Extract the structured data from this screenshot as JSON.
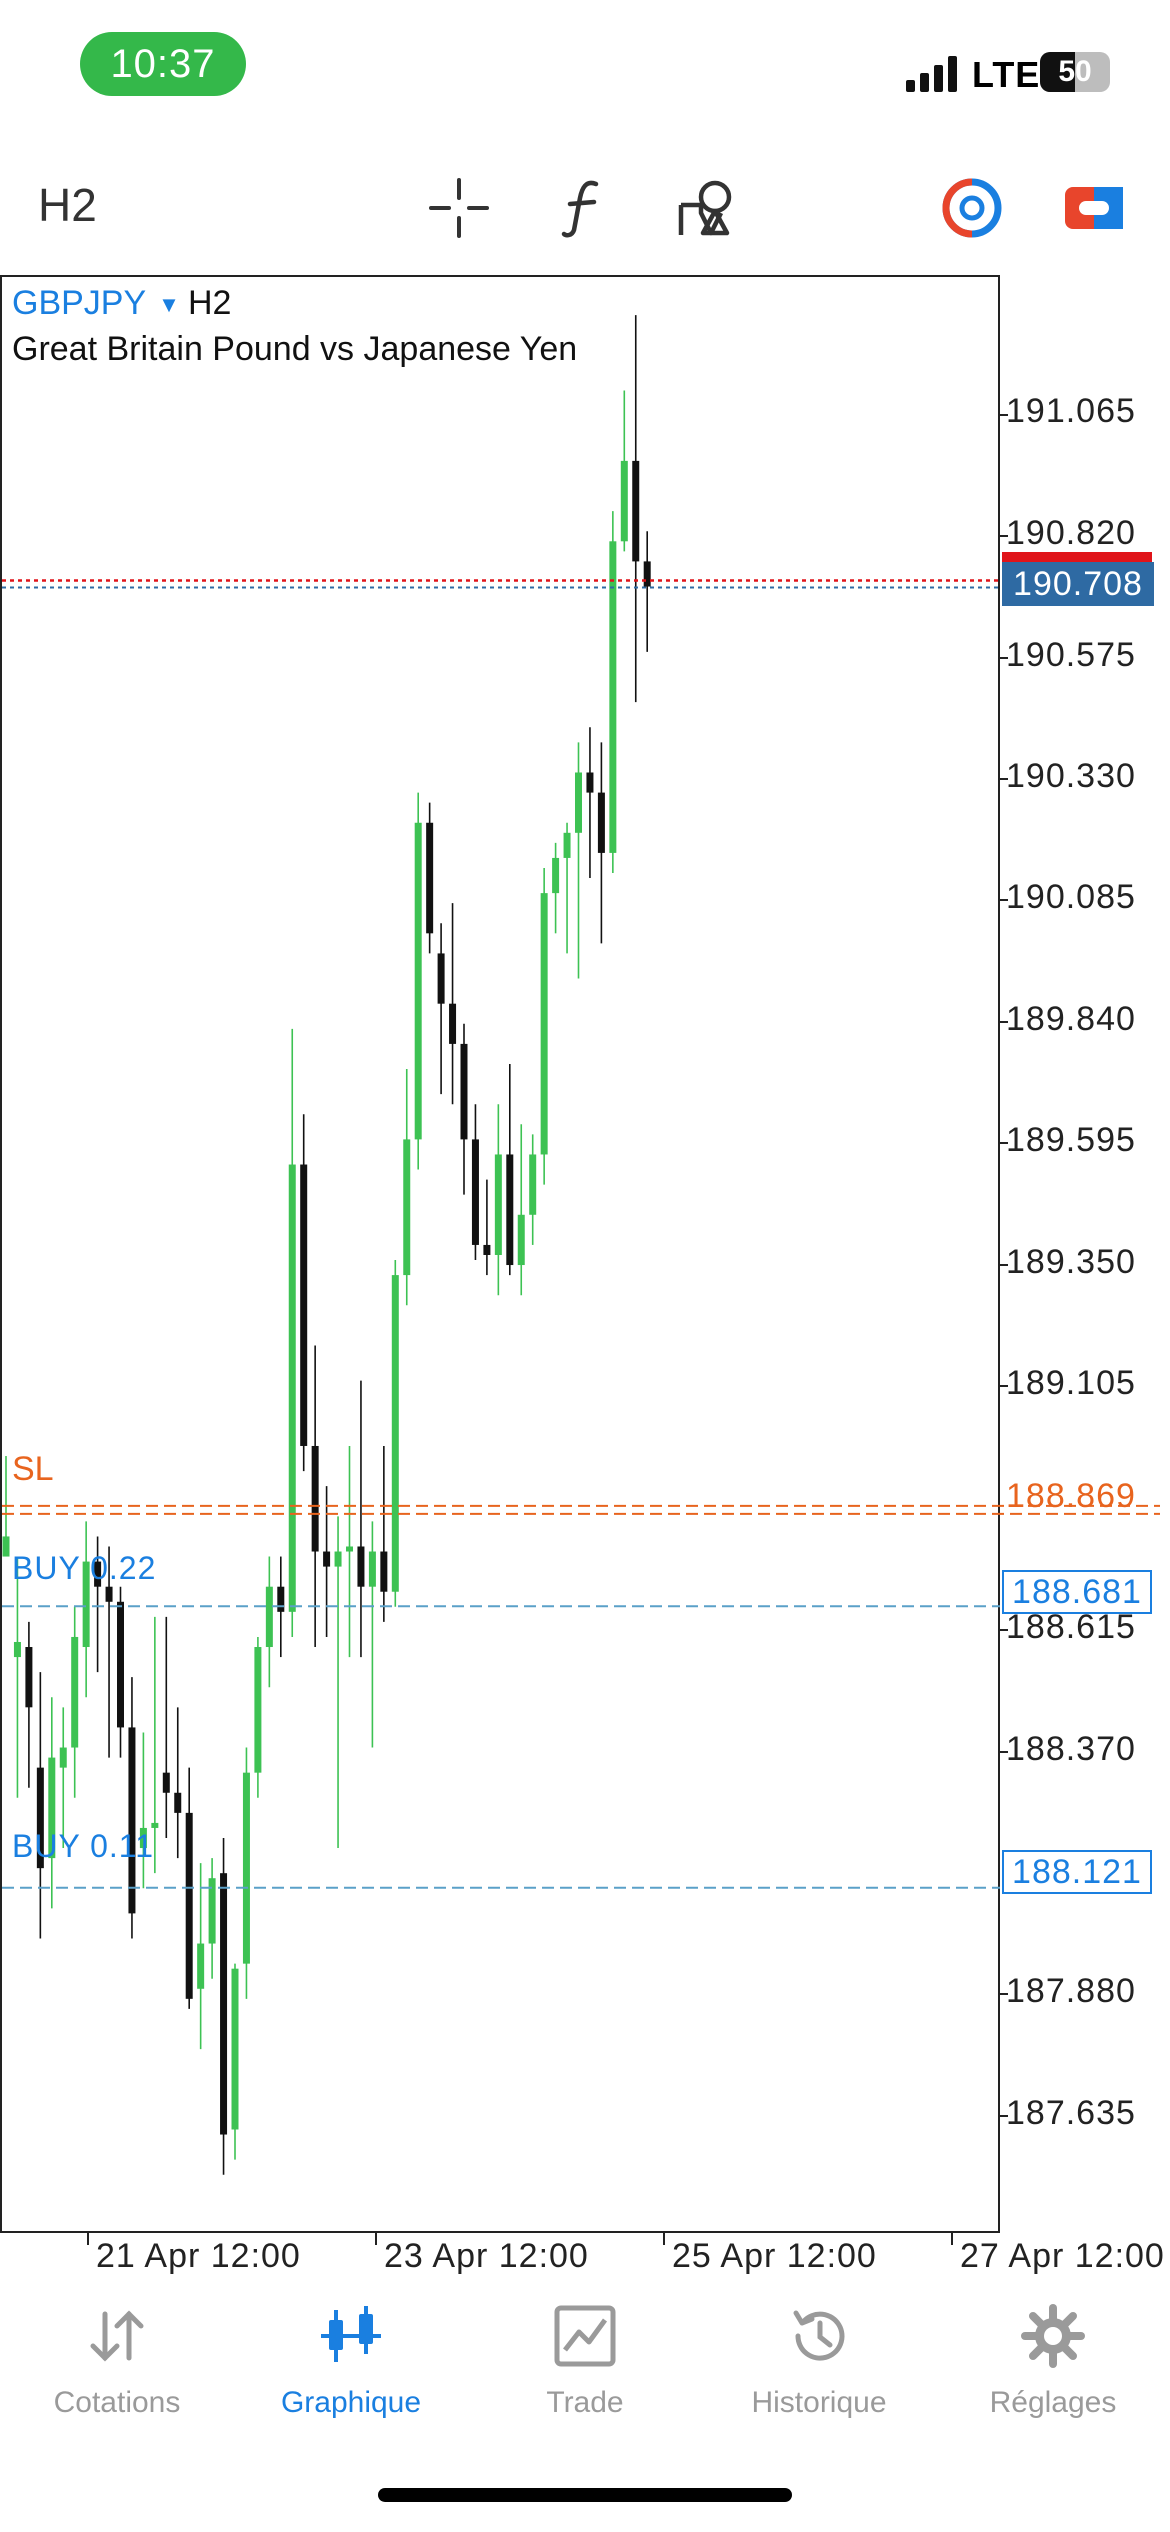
{
  "status_bar": {
    "time": "10:37",
    "network": "LTE",
    "battery": "50",
    "battery_level": 0.5
  },
  "toolbar": {
    "timeframe": "H2",
    "icons": [
      "crosshair-icon",
      "indicator-f-icon",
      "objects-icon",
      "one-click-trading-icon",
      "trade-ticket-icon"
    ]
  },
  "chart": {
    "symbol": "GBPJPY",
    "symbol_arrow": "▼",
    "timeframe": "H2",
    "description": "Great Britain Pound vs Japanese Yen",
    "price_ticks": [
      "191.065",
      "190.820",
      "190.575",
      "190.330",
      "190.085",
      "189.840",
      "189.595",
      "189.350",
      "189.105",
      "188.615",
      "188.370",
      "187.880",
      "187.635"
    ],
    "date_ticks": [
      "21 Apr 12:00",
      "23 Apr 12:00",
      "25 Apr 12:00",
      "27 Apr 12:00"
    ],
    "current_price": "190.708",
    "sl_label": "SL",
    "sl_price": "188.869",
    "orders": [
      {
        "label": "BUY 0.22",
        "price": "188.681"
      },
      {
        "label": "BUY 0.11",
        "price": "188.121"
      }
    ],
    "colors": {
      "bull": "#3dc253",
      "bear": "#111111",
      "sl": "#e8641e",
      "buy": "#1a7fe0",
      "bid": "#e0141a",
      "ask": "#2e6aa3"
    }
  },
  "chart_data": {
    "type": "candlestick",
    "ylim": [
      187.45,
      191.3
    ],
    "candles": [
      {
        "o": 188.78,
        "h": 188.98,
        "l": 188.8,
        "c": 188.82
      },
      {
        "o": 188.58,
        "h": 188.78,
        "l": 188.3,
        "c": 188.61
      },
      {
        "o": 188.6,
        "h": 188.65,
        "l": 188.32,
        "c": 188.48
      },
      {
        "o": 188.36,
        "h": 188.55,
        "l": 188.02,
        "c": 188.16
      },
      {
        "o": 188.18,
        "h": 188.5,
        "l": 188.08,
        "c": 188.38
      },
      {
        "o": 188.36,
        "h": 188.48,
        "l": 188.2,
        "c": 188.4
      },
      {
        "o": 188.4,
        "h": 188.68,
        "l": 188.3,
        "c": 188.62
      },
      {
        "o": 188.6,
        "h": 188.85,
        "l": 188.5,
        "c": 188.77
      },
      {
        "o": 188.77,
        "h": 188.82,
        "l": 188.55,
        "c": 188.72
      },
      {
        "o": 188.72,
        "h": 188.8,
        "l": 188.38,
        "c": 188.69
      },
      {
        "o": 188.69,
        "h": 188.72,
        "l": 188.38,
        "c": 188.44
      },
      {
        "o": 188.44,
        "h": 188.54,
        "l": 188.02,
        "c": 188.07
      },
      {
        "o": 188.2,
        "h": 188.43,
        "l": 188.12,
        "c": 188.24
      },
      {
        "o": 188.24,
        "h": 188.66,
        "l": 188.15,
        "c": 188.25
      },
      {
        "o": 188.35,
        "h": 188.66,
        "l": 188.22,
        "c": 188.31
      },
      {
        "o": 188.31,
        "h": 188.48,
        "l": 188.18,
        "c": 188.27
      },
      {
        "o": 188.27,
        "h": 188.36,
        "l": 187.88,
        "c": 187.9
      },
      {
        "o": 187.92,
        "h": 188.17,
        "l": 187.8,
        "c": 188.01
      },
      {
        "o": 188.01,
        "h": 188.18,
        "l": 187.94,
        "c": 188.14
      },
      {
        "o": 188.15,
        "h": 188.22,
        "l": 187.55,
        "c": 187.63
      },
      {
        "o": 187.64,
        "h": 187.97,
        "l": 187.58,
        "c": 187.96
      },
      {
        "o": 187.97,
        "h": 188.4,
        "l": 187.9,
        "c": 188.35
      },
      {
        "o": 188.35,
        "h": 188.62,
        "l": 188.3,
        "c": 188.6
      },
      {
        "o": 188.6,
        "h": 188.78,
        "l": 188.52,
        "c": 188.72
      },
      {
        "o": 188.72,
        "h": 188.78,
        "l": 188.58,
        "c": 188.67
      },
      {
        "o": 188.67,
        "h": 189.83,
        "l": 188.62,
        "c": 189.56
      },
      {
        "o": 189.56,
        "h": 189.66,
        "l": 188.95,
        "c": 189.0
      },
      {
        "o": 189.0,
        "h": 189.2,
        "l": 188.6,
        "c": 188.79
      },
      {
        "o": 188.79,
        "h": 188.92,
        "l": 188.62,
        "c": 188.76
      },
      {
        "o": 188.76,
        "h": 188.86,
        "l": 188.2,
        "c": 188.79
      },
      {
        "o": 188.79,
        "h": 189.0,
        "l": 188.58,
        "c": 188.8
      },
      {
        "o": 188.8,
        "h": 189.13,
        "l": 188.58,
        "c": 188.72
      },
      {
        "o": 188.72,
        "h": 188.85,
        "l": 188.4,
        "c": 188.79
      },
      {
        "o": 188.79,
        "h": 189.0,
        "l": 188.65,
        "c": 188.71
      },
      {
        "o": 188.71,
        "h": 189.37,
        "l": 188.68,
        "c": 189.34
      },
      {
        "o": 189.34,
        "h": 189.75,
        "l": 189.28,
        "c": 189.61
      },
      {
        "o": 189.61,
        "h": 190.3,
        "l": 189.55,
        "c": 190.24
      },
      {
        "o": 190.24,
        "h": 190.28,
        "l": 189.98,
        "c": 190.02
      },
      {
        "o": 189.98,
        "h": 190.04,
        "l": 189.7,
        "c": 189.88
      },
      {
        "o": 189.88,
        "h": 190.08,
        "l": 189.68,
        "c": 189.8
      },
      {
        "o": 189.8,
        "h": 189.84,
        "l": 189.5,
        "c": 189.61
      },
      {
        "o": 189.61,
        "h": 189.68,
        "l": 189.37,
        "c": 189.4
      },
      {
        "o": 189.4,
        "h": 189.53,
        "l": 189.34,
        "c": 189.38
      },
      {
        "o": 189.38,
        "h": 189.68,
        "l": 189.3,
        "c": 189.58
      },
      {
        "o": 189.58,
        "h": 189.76,
        "l": 189.34,
        "c": 189.36
      },
      {
        "o": 189.36,
        "h": 189.64,
        "l": 189.3,
        "c": 189.46
      },
      {
        "o": 189.46,
        "h": 189.62,
        "l": 189.4,
        "c": 189.58
      },
      {
        "o": 189.58,
        "h": 190.15,
        "l": 189.52,
        "c": 190.1
      },
      {
        "o": 190.1,
        "h": 190.2,
        "l": 190.02,
        "c": 190.17
      },
      {
        "o": 190.17,
        "h": 190.24,
        "l": 189.98,
        "c": 190.22
      },
      {
        "o": 190.22,
        "h": 190.4,
        "l": 189.93,
        "c": 190.34
      },
      {
        "o": 190.34,
        "h": 190.43,
        "l": 190.13,
        "c": 190.3
      },
      {
        "o": 190.3,
        "h": 190.4,
        "l": 190.0,
        "c": 190.18
      },
      {
        "o": 190.18,
        "h": 190.86,
        "l": 190.14,
        "c": 190.8
      },
      {
        "o": 190.8,
        "h": 191.1,
        "l": 190.78,
        "c": 190.96
      },
      {
        "o": 190.96,
        "h": 191.25,
        "l": 190.48,
        "c": 190.76
      },
      {
        "o": 190.76,
        "h": 190.82,
        "l": 190.58,
        "c": 190.71
      }
    ]
  },
  "tabs": [
    {
      "label": "Cotations",
      "icon": "quotes-arrows-icon",
      "active": false
    },
    {
      "label": "Graphique",
      "icon": "candlestick-chart-icon",
      "active": true
    },
    {
      "label": "Trade",
      "icon": "trade-chart-icon",
      "active": false
    },
    {
      "label": "Historique",
      "icon": "history-clock-icon",
      "active": false
    },
    {
      "label": "Réglages",
      "icon": "settings-gear-icon",
      "active": false
    }
  ]
}
